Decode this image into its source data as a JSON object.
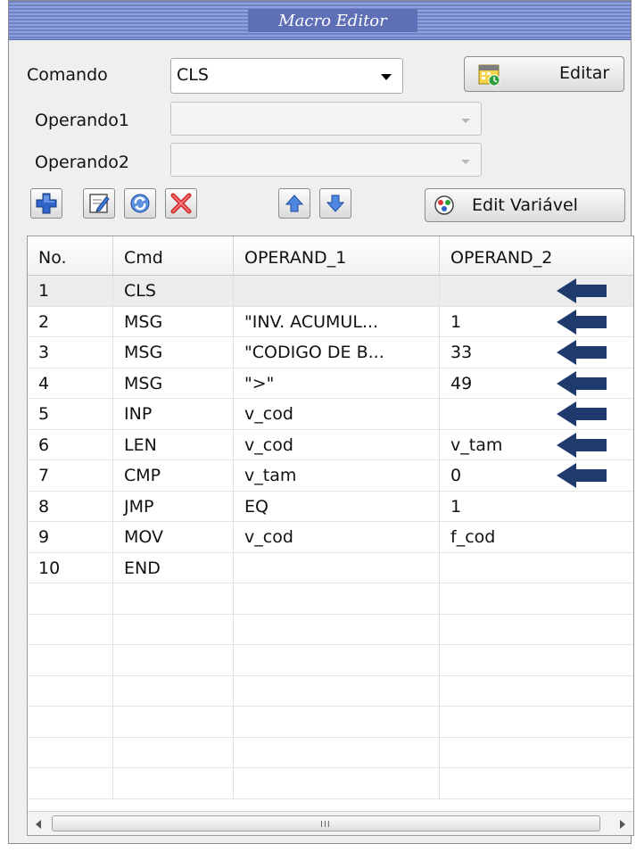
{
  "window": {
    "title": "Macro Editor"
  },
  "form": {
    "comando_label": "Comando",
    "comando_value": "CLS",
    "operando1_label": "Operando1",
    "operando1_value": "",
    "operando2_label": "Operando2",
    "operando2_value": ""
  },
  "buttons": {
    "editar": "Editar",
    "edit_variavel": "Edit Variável"
  },
  "toolbar": {
    "icons": [
      "add-icon",
      "edit-icon",
      "refresh-icon",
      "delete-icon",
      "move-up-icon",
      "move-down-icon"
    ]
  },
  "table": {
    "columns": [
      "No.",
      "Cmd",
      "OPERAND_1",
      "OPERAND_2"
    ],
    "rows": [
      [
        "1",
        "CLS",
        "",
        ""
      ],
      [
        "2",
        "MSG",
        "\"INV. ACUMUL...",
        "1"
      ],
      [
        "3",
        "MSG",
        "\"CODIGO DE B...",
        "33"
      ],
      [
        "4",
        "MSG",
        "\">\"",
        "49"
      ],
      [
        "5",
        "INP",
        "v_cod",
        ""
      ],
      [
        "6",
        "LEN",
        "v_cod",
        "v_tam"
      ],
      [
        "7",
        "CMP",
        "v_tam",
        "0"
      ],
      [
        "8",
        "JMP",
        "EQ",
        "1"
      ],
      [
        "9",
        "MOV",
        "v_cod",
        "f_cod"
      ],
      [
        "10",
        "END",
        "",
        ""
      ],
      [
        "",
        "",
        "",
        ""
      ],
      [
        "",
        "",
        "",
        ""
      ],
      [
        "",
        "",
        "",
        ""
      ],
      [
        "",
        "",
        "",
        ""
      ],
      [
        "",
        "",
        "",
        ""
      ],
      [
        "",
        "",
        "",
        ""
      ],
      [
        "",
        "",
        "",
        ""
      ]
    ],
    "selected_row": 0,
    "scroll_grip": "III"
  },
  "annotations": {
    "arrow_rows": [
      0,
      1,
      2,
      3,
      4,
      5,
      6
    ],
    "arrow_color": "#1f3b6e"
  },
  "colors": {
    "titlebar": "#6f82c7",
    "accent_add": "#2e63c8",
    "accent_delete": "#d22b2b"
  }
}
